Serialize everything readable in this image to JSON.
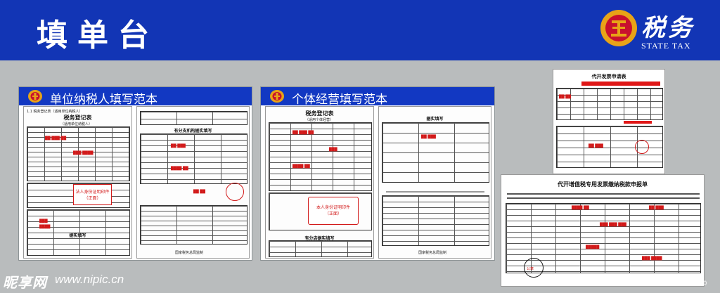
{
  "header": {
    "title": "填单台",
    "logo_cn": "税务",
    "logo_en": "STATE TAX",
    "background": "#1235b5"
  },
  "panels": {
    "unit": {
      "title": "单位纳税人填写范本",
      "form1_title": "税务登记表",
      "form1_subtitle": "（适用单位纳税人）",
      "form1_section": "1.1 税务登记表（适用单位纳税人）",
      "form1_red": "法人身份证明印件",
      "form1_red2": "（正面）",
      "form1_sub_title": "据实填写",
      "form1_footer": "国家税务总局监制",
      "form2_title": "有分支机构据实填写",
      "form2_footer": "国家税务总局监制"
    },
    "individual": {
      "title": "个体经营填写范本",
      "form1_title": "税务登记表",
      "form1_subtitle": "（适用个体经营）",
      "form1_red": "本人身份证明印件",
      "form1_red2": "（正面）",
      "form1_footer": "有分店据实填写",
      "form2_title": "据实填写",
      "form2_footer": "国家税务总局监制"
    }
  },
  "invoice_request": {
    "title": "代开发票申请表"
  },
  "vat_report": {
    "title": "代开增值税专用发票缴纳税款申报单",
    "seal_text": "公章"
  },
  "watermark": {
    "site_cn": "昵享网",
    "url": "www.nipic.cn",
    "id": "ID:6528304 NO:20140426154050968000"
  },
  "colors": {
    "brand_blue": "#1235b5",
    "stamp_red": "#d21a1a",
    "logo_gold": "#e8a317",
    "logo_red": "#c8102e"
  }
}
